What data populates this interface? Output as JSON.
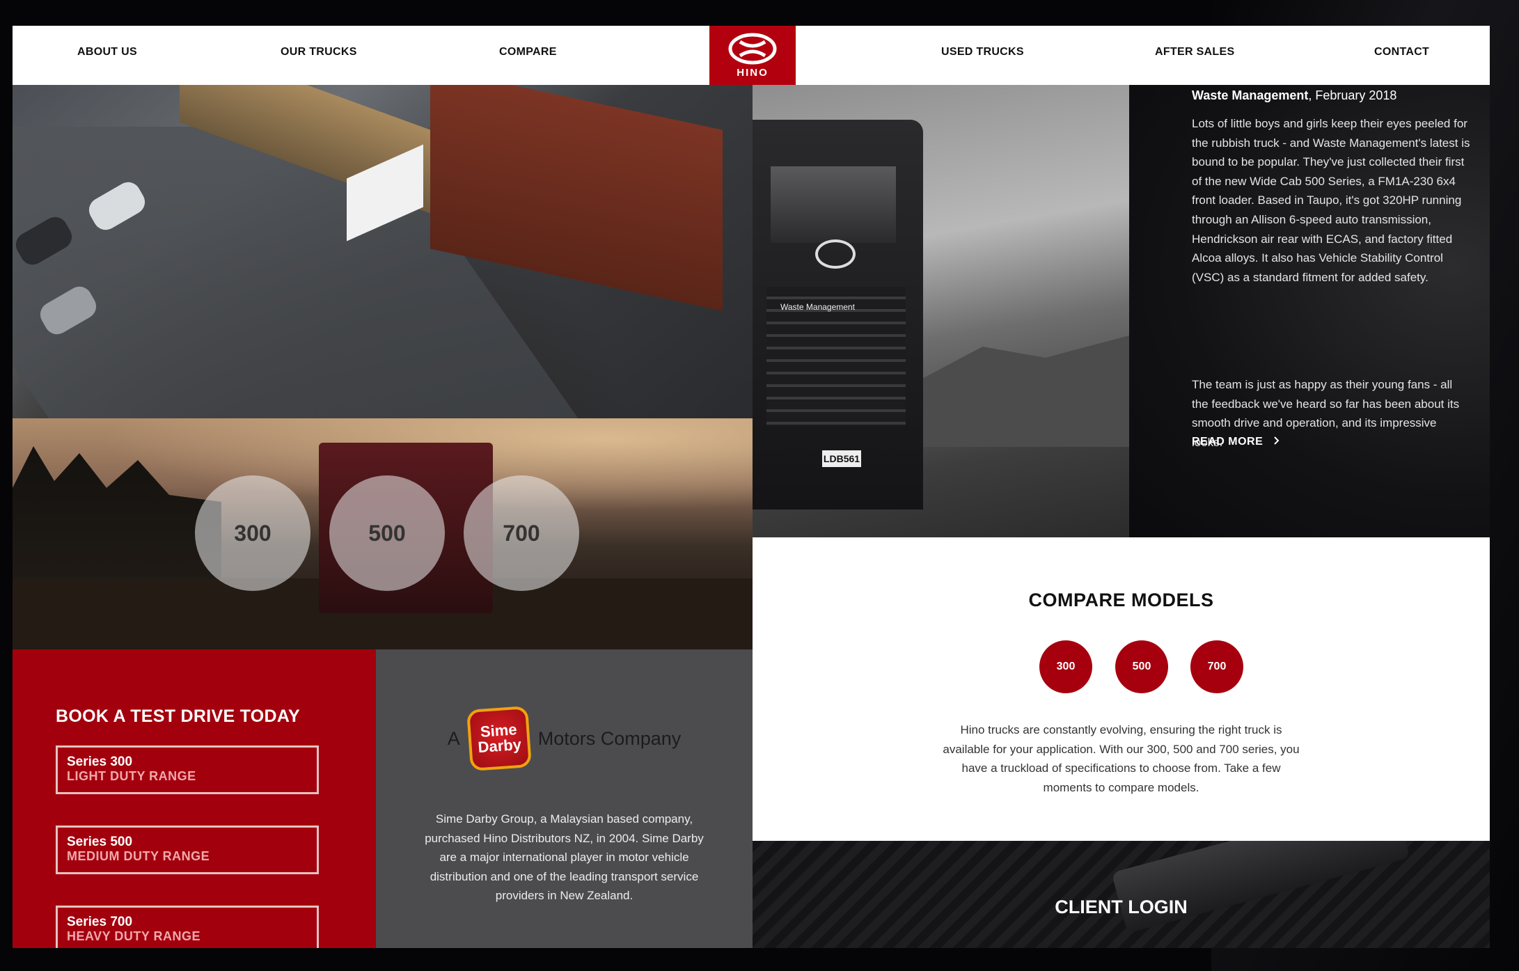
{
  "nav": {
    "left": [
      "ABOUT US",
      "OUR TRUCKS",
      "COMPARE"
    ],
    "right": [
      "USED TRUCKS",
      "AFTER SALES",
      "CONTACT"
    ],
    "logo_text": "HINO"
  },
  "hero_models": [
    "300",
    "500",
    "700"
  ],
  "book": {
    "title": "BOOK A TEST DRIVE TODAY",
    "series": [
      {
        "name": "Series 300",
        "range": "LIGHT DUTY RANGE"
      },
      {
        "name": "Series 500",
        "range": "MEDIUM DUTY RANGE"
      },
      {
        "name": "Series 700",
        "range": "HEAVY DUTY RANGE"
      }
    ]
  },
  "sime": {
    "prefix": "A",
    "logo_line1": "Sime",
    "logo_line2": "Darby",
    "suffix": "Motors Company",
    "text": "Sime Darby Group, a Malaysian based company, purchased Hino Distributors NZ, in 2004. Sime Darby are a major international player in motor vehicle distribution and one of the leading transport service providers in New Zealand."
  },
  "news": {
    "company": "Waste Management",
    "date": ", February 2018",
    "para1": "Lots of little boys and girls keep their eyes peeled for the rubbish truck - and Waste Management's latest is bound to be popular. They've just collected their first of the new Wide Cab 500 Series, a FM1A-230 6x4 front loader. Based in Taupo, it's got 320HP running through an Allison 6-speed auto transmission, Hendrickson air rear with ECAS, and factory fitted Alcoa alloys. It also has Vehicle Stability Control (VSC) as a standard fitment for added safety.",
    "para2": "The team is just as happy as their young fans - all the feedback we've heard so far has been about its smooth drive and operation, and its impressive looks.",
    "read_more": "READ MORE",
    "truck_badge": "Waste Management",
    "plate": "LDB561"
  },
  "compare": {
    "title": "COMPARE MODELS",
    "models": [
      "300",
      "500",
      "700"
    ],
    "text": "Hino trucks are constantly evolving, ensuring the right truck is available for your application. With our 300, 500 and 700 series, you have a truckload of specifications to choose from. Take a few moments to compare models."
  },
  "client": {
    "title": "CLIENT LOGIN"
  },
  "colors": {
    "brand_red": "#b3000e",
    "panel_grey": "#4c4c4f"
  }
}
